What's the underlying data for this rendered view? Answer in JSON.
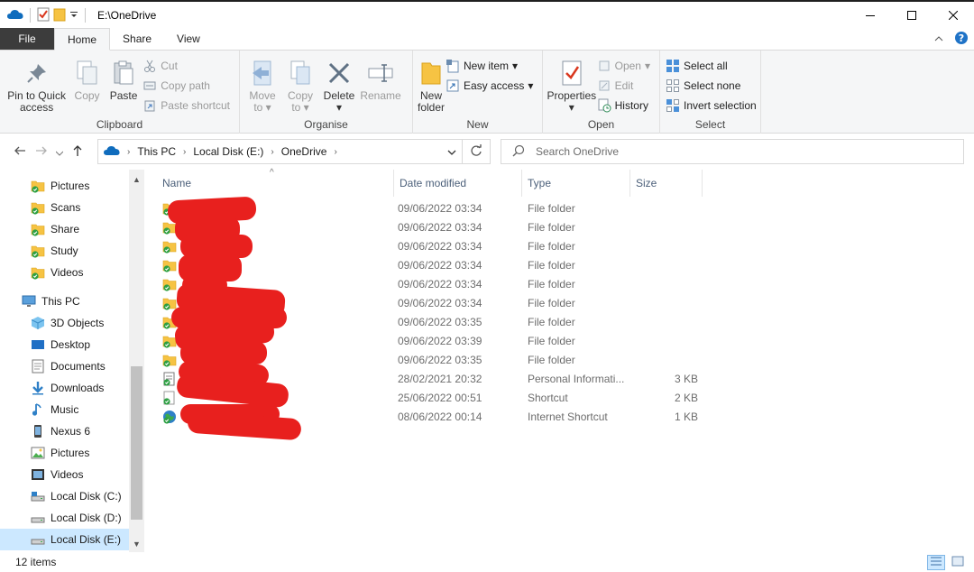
{
  "window": {
    "title": "E:\\OneDrive"
  },
  "tabs": [
    "File",
    "Home",
    "Share",
    "View"
  ],
  "ribbon": {
    "clipboard": {
      "label": "Clipboard",
      "pin_line1": "Pin to Quick",
      "pin_line2": "access",
      "copy": "Copy",
      "paste": "Paste",
      "cut": "Cut",
      "copy_path": "Copy path",
      "paste_shortcut": "Paste shortcut"
    },
    "organise": {
      "label": "Organise",
      "move_line1": "Move",
      "move_line2": "to",
      "copy_line1": "Copy",
      "copy_line2": "to",
      "delete": "Delete",
      "rename": "Rename"
    },
    "new": {
      "label": "New",
      "folder_line1": "New",
      "folder_line2": "folder",
      "new_item": "New item",
      "easy_access": "Easy access"
    },
    "open": {
      "label": "Open",
      "properties": "Properties",
      "open": "Open",
      "edit": "Edit",
      "history": "History"
    },
    "select": {
      "label": "Select",
      "select_all": "Select all",
      "select_none": "Select none",
      "invert": "Invert selection"
    }
  },
  "address": {
    "crumbs": [
      "This PC",
      "Local Disk (E:)",
      "OneDrive"
    ],
    "search_placeholder": "Search OneDrive"
  },
  "nav": [
    {
      "label": "Pictures",
      "icon": "folder-sync"
    },
    {
      "label": "Scans",
      "icon": "folder-sync"
    },
    {
      "label": "Share",
      "icon": "folder-sync"
    },
    {
      "label": "Study",
      "icon": "folder-sync"
    },
    {
      "label": "Videos",
      "icon": "folder-sync"
    },
    {
      "label": "This PC",
      "icon": "pc"
    },
    {
      "label": "3D Objects",
      "icon": "3d"
    },
    {
      "label": "Desktop",
      "icon": "desktop"
    },
    {
      "label": "Documents",
      "icon": "documents"
    },
    {
      "label": "Downloads",
      "icon": "downloads"
    },
    {
      "label": "Music",
      "icon": "music"
    },
    {
      "label": "Nexus 6",
      "icon": "phone"
    },
    {
      "label": "Pictures",
      "icon": "pictures"
    },
    {
      "label": "Videos",
      "icon": "videos"
    },
    {
      "label": "Local Disk (C:)",
      "icon": "disk-c"
    },
    {
      "label": "Local Disk (D:)",
      "icon": "disk"
    },
    {
      "label": "Local Disk (E:)",
      "icon": "disk"
    }
  ],
  "columns": {
    "name": "Name",
    "date": "Date modified",
    "type": "Type",
    "size": "Size"
  },
  "files": [
    {
      "date": "09/06/2022 03:34",
      "type": "File folder",
      "size": "",
      "icon": "folder"
    },
    {
      "date": "09/06/2022 03:34",
      "type": "File folder",
      "size": "",
      "icon": "folder"
    },
    {
      "date": "09/06/2022 03:34",
      "type": "File folder",
      "size": "",
      "icon": "folder"
    },
    {
      "date": "09/06/2022 03:34",
      "type": "File folder",
      "size": "",
      "icon": "folder"
    },
    {
      "date": "09/06/2022 03:34",
      "type": "File folder",
      "size": "",
      "icon": "folder"
    },
    {
      "date": "09/06/2022 03:34",
      "type": "File folder",
      "size": "",
      "icon": "folder"
    },
    {
      "date": "09/06/2022 03:35",
      "type": "File folder",
      "size": "",
      "icon": "folder"
    },
    {
      "date": "09/06/2022 03:39",
      "type": "File folder",
      "size": "",
      "icon": "folder"
    },
    {
      "date": "09/06/2022 03:35",
      "type": "File folder",
      "size": "",
      "icon": "folder"
    },
    {
      "date": "28/02/2021 20:32",
      "type": "Personal Informati...",
      "size": "3 KB",
      "icon": "file"
    },
    {
      "date": "25/06/2022 00:51",
      "type": "Shortcut",
      "size": "2 KB",
      "icon": "shortcut"
    },
    {
      "date": "08/06/2022 00:14",
      "type": "Internet Shortcut",
      "size": "1 KB",
      "icon": "globe"
    }
  ],
  "status": {
    "items": "12 items"
  },
  "colors": {
    "accent": "#2b579a",
    "redaction": "#e8201e",
    "selected": "#cce8ff",
    "sync": "#2ea043"
  }
}
